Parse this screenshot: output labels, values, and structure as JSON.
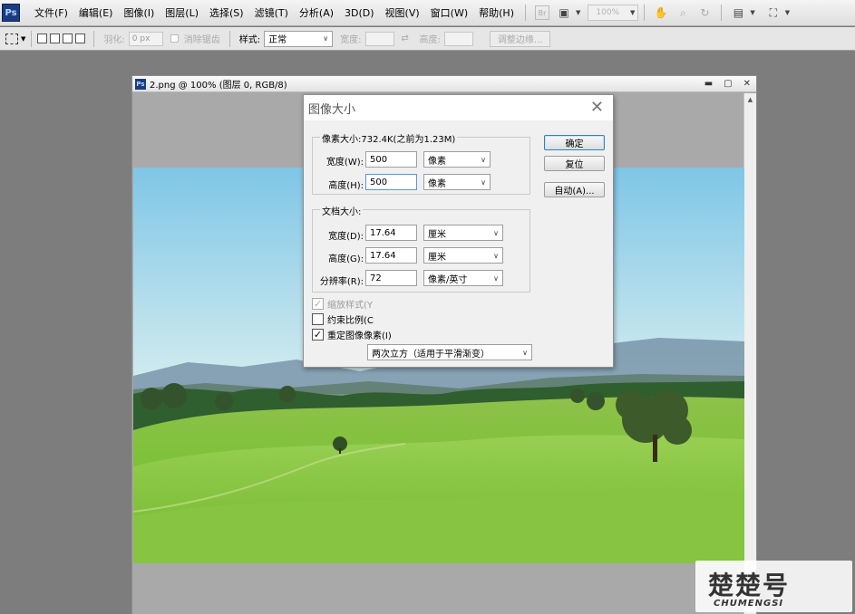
{
  "app": {
    "logo": "Ps"
  },
  "menu": [
    "文件(F)",
    "编辑(E)",
    "图像(I)",
    "图层(L)",
    "选择(S)",
    "滤镜(T)",
    "分析(A)",
    "3D(D)",
    "视图(V)",
    "窗口(W)",
    "帮助(H)"
  ],
  "toolbar": {
    "br_label": "Br",
    "zoom_value": "100%"
  },
  "options": {
    "feather_label": "羽化:",
    "feather_value": "0 px",
    "antialias_label": "消除锯齿",
    "style_label": "样式:",
    "style_value": "正常",
    "width_label": "宽度:",
    "height_label": "高度:",
    "refine_label": "调整边缘..."
  },
  "document": {
    "title": "2.png @ 100% (图层 0, RGB/8)"
  },
  "dialog": {
    "title": "图像大小",
    "pixel_dim_label": "像素大小:732.4K(之前为1.23M)",
    "px_width_label": "宽度(W):",
    "px_width_value": "500",
    "px_width_unit": "像素",
    "px_height_label": "高度(H):",
    "px_height_value": "500",
    "px_height_unit": "像素",
    "doc_size_label": "文档大小:",
    "doc_width_label": "宽度(D):",
    "doc_width_value": "17.64",
    "doc_width_unit": "厘米",
    "doc_height_label": "高度(G):",
    "doc_height_value": "17.64",
    "doc_height_unit": "厘米",
    "resolution_label": "分辨率(R):",
    "resolution_value": "72",
    "resolution_unit": "像素/英寸",
    "scale_styles_label": "缩放样式(Y",
    "constrain_label": "约束比例(C",
    "resample_label": "重定图像像素(I)",
    "resample_method": "两次立方（适用于平滑渐变）",
    "ok_label": "确定",
    "reset_label": "复位",
    "auto_label": "自动(A)...",
    "checks": {
      "scale_styles": true,
      "constrain": false,
      "resample": true
    }
  },
  "watermark": {
    "main": "楚楚号",
    "sub": "CHUMENGSI"
  }
}
